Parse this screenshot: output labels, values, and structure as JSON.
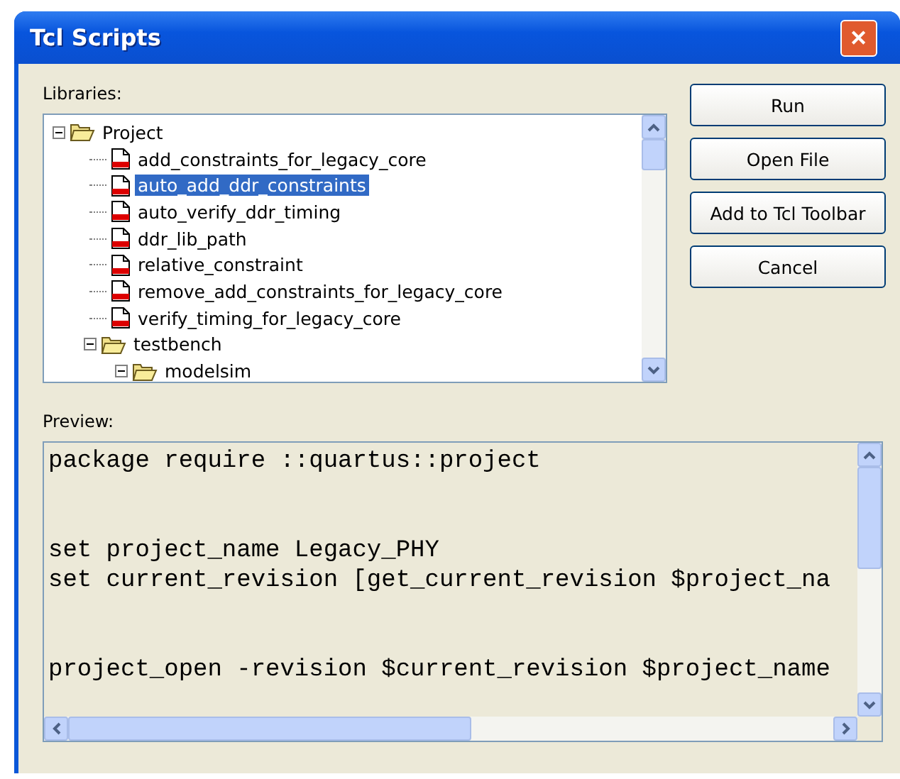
{
  "window": {
    "title": "Tcl Scripts",
    "close": "✕"
  },
  "libraries": {
    "label": "Libraries:",
    "tree": [
      {
        "kind": "folder",
        "label": "Project",
        "expanded": true,
        "selected": false,
        "children": [
          {
            "kind": "script",
            "label": "add_constraints_for_legacy_core",
            "selected": false
          },
          {
            "kind": "script",
            "label": "auto_add_ddr_constraints",
            "selected": true
          },
          {
            "kind": "script",
            "label": "auto_verify_ddr_timing",
            "selected": false
          },
          {
            "kind": "script",
            "label": "ddr_lib_path",
            "selected": false
          },
          {
            "kind": "script",
            "label": "relative_constraint",
            "selected": false
          },
          {
            "kind": "script",
            "label": "remove_add_constraints_for_legacy_core",
            "selected": false
          },
          {
            "kind": "script",
            "label": "verify_timing_for_legacy_core",
            "selected": false
          },
          {
            "kind": "folder",
            "label": "testbench",
            "expanded": true,
            "selected": false,
            "children": [
              {
                "kind": "folder",
                "label": "modelsim",
                "expanded": true,
                "selected": false
              }
            ]
          }
        ]
      }
    ]
  },
  "buttons": [
    "Run",
    "Open File",
    "Add to Tcl Toolbar",
    "Cancel"
  ],
  "preview": {
    "label": "Preview:",
    "lines": [
      {
        "text": "package require ::quartus::project",
        "spaced": false
      },
      {
        "text": "set project_name Legacy_PHY",
        "spaced": true
      },
      {
        "text": "set current_revision [get_current_revision $project_na",
        "spaced": false
      },
      {
        "text": "project_open -revision $current_revision $project_name",
        "spaced": true
      }
    ]
  }
}
